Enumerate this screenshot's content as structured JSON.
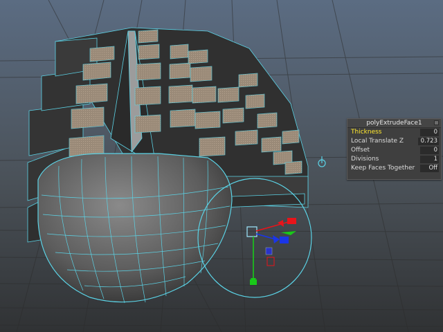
{
  "colors": {
    "viewport_top": "#5a6b80",
    "viewport_bottom": "#2f3133",
    "wire": "#5bd3e6",
    "accent_label": "#ffe82e",
    "manip_x": "#e8141a",
    "manip_y": "#19c919",
    "manip_z": "#1a35e8"
  },
  "attribute_panel": {
    "title": "polyExtrudeFace1",
    "close_icon": "close-icon",
    "rows": [
      {
        "label": "Thickness",
        "value": "0"
      },
      {
        "label": "Local Translate Z",
        "value": "0.723"
      },
      {
        "label": "Offset",
        "value": "0"
      },
      {
        "label": "Divisions",
        "value": "1"
      },
      {
        "label": "Keep Faces Together",
        "value": "Off"
      }
    ]
  },
  "viewport": {
    "model": "extruded-sphere",
    "pivot_icon": "pivot-icon",
    "manipulator_icon": "move-manipulator-icon"
  }
}
